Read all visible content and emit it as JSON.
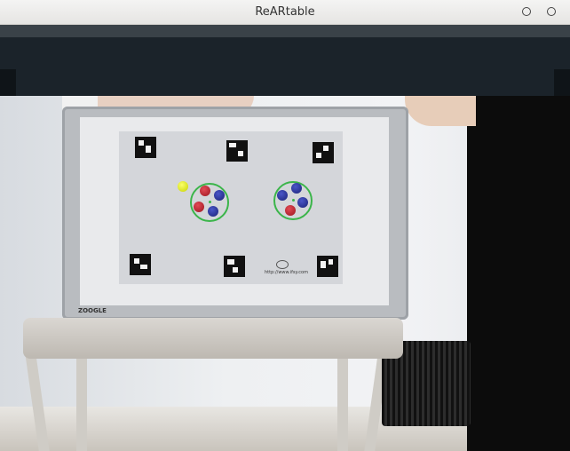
{
  "window": {
    "title": "ReARtable",
    "buttons": [
      "minimize",
      "close"
    ]
  },
  "camera_view": {
    "sheet_url": "http://www.ifsy.com",
    "board_brand": "ZOOGLE"
  },
  "colors": {
    "title_bar": "#e6e5e3",
    "overlay_bar": "#1b232a",
    "detection_ring": "#3bb54a",
    "token_red": "#c0202c",
    "token_blue": "#262c9a",
    "token_yellow": "#e6f000"
  },
  "icons": {
    "minimize": "circle-outline-icon",
    "close": "circle-outline-icon"
  }
}
